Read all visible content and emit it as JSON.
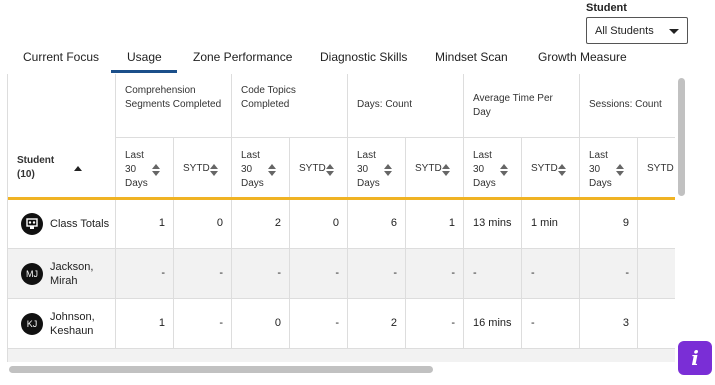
{
  "filter": {
    "label": "Student",
    "value": "All Students"
  },
  "tabs": [
    {
      "label": "Current Focus",
      "active": false
    },
    {
      "label": "Usage",
      "active": true
    },
    {
      "label": "Zone Performance",
      "active": false
    },
    {
      "label": "Diagnostic Skills",
      "active": false
    },
    {
      "label": "Mindset Scan",
      "active": false
    },
    {
      "label": "Growth Measure",
      "active": false
    }
  ],
  "table": {
    "student_header": "Student\n(10)",
    "groups": [
      {
        "label": "Comprehension Segments Completed"
      },
      {
        "label": "Code Topics Completed"
      },
      {
        "label": "Days: Count"
      },
      {
        "label": "Average Time Per Day"
      },
      {
        "label": "Sessions: Count"
      }
    ],
    "sub_headers": [
      "Last\n30\nDays",
      "SYTD"
    ],
    "rows": [
      {
        "name": "Class Totals",
        "avatar": "class-icon",
        "cells": [
          "1",
          "0",
          "2",
          "0",
          "6",
          "1",
          "13 mins",
          "1 min",
          "9",
          ""
        ]
      },
      {
        "name": "Jackson,\nMirah",
        "avatar": "MJ",
        "cells": [
          "-",
          "-",
          "-",
          "-",
          "-",
          "-",
          "-",
          "-",
          "-",
          ""
        ]
      },
      {
        "name": "Johnson,\nKeshaun",
        "avatar": "KJ",
        "cells": [
          "1",
          "-",
          "0",
          "-",
          "2",
          "-",
          "16 mins",
          "-",
          "3",
          ""
        ]
      }
    ]
  },
  "info_button": {
    "icon": "info-icon",
    "glyph": "i",
    "color": "#7a2ed6"
  },
  "colors": {
    "accent_underline": "#1b4f8a",
    "header_rule": "#f0b323"
  }
}
